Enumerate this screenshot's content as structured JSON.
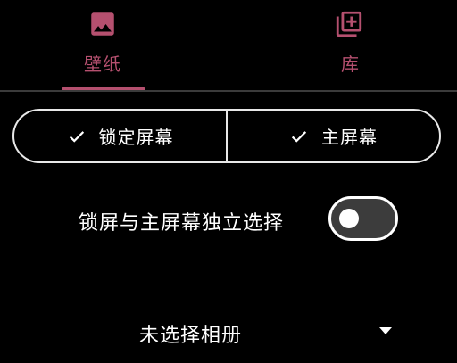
{
  "tabs": [
    {
      "label": "壁纸",
      "icon": "image-icon",
      "selected": true
    },
    {
      "label": "库",
      "icon": "library-add-icon",
      "selected": false
    }
  ],
  "segments": [
    {
      "label": "锁定屏幕",
      "icon": "check-icon",
      "selected": true
    },
    {
      "label": "主屏幕",
      "icon": "check-icon",
      "selected": true
    }
  ],
  "independent_toggle": {
    "label": "锁屏与主屏幕独立选择",
    "on": false
  },
  "album": {
    "label": "未选择相册",
    "icon": "dropdown-arrow-icon"
  },
  "colors": {
    "accent": "#b5506f",
    "background": "#000000",
    "text": "#ffffff",
    "divider": "#3b3b3b",
    "switch_track": "#3c3c3c"
  }
}
